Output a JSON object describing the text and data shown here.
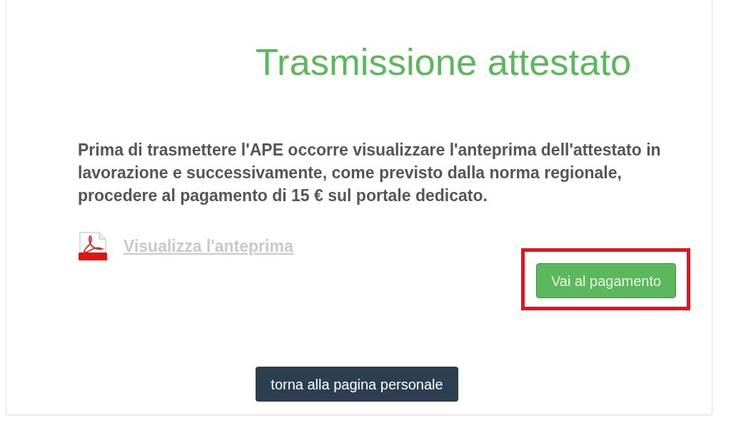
{
  "title": "Trasmissione attestato",
  "message": "Prima di trasmettere l'APE occorre visualizzare l'anteprima dell'attestato in lavorazione e successivamente, come previsto dalla norma regionale, procedere al pagamento di 15 € sul portale dedicato.",
  "preview_link": {
    "label": "Visualizza l'anteprima",
    "disabled": true
  },
  "pay_button": {
    "label": "Vai al pagamento",
    "highlighted": true
  },
  "back_button": {
    "label": "torna alla pagina personale"
  }
}
